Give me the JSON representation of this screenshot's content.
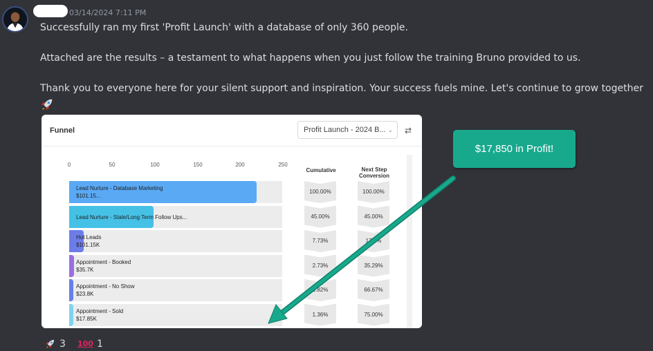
{
  "message": {
    "timestamp": "03/14/2024 7:11 PM",
    "line1": "Successfully ran my first 'Profit Launch' with a database of only 360 people.",
    "line2": "Attached are the results – a testament to what happens when you just follow the training Bruno provided to us.",
    "line3": "Thank you to everyone here for your silent support and inspiration. Your success fuels mine. Let's continue to grow together",
    "emoji": "rocket-icon"
  },
  "funnel_card": {
    "title": "Funnel",
    "dropdown_value": "Profit Launch - 2024 B...",
    "filter_icon": "swap-icon",
    "axis_ticks": [
      "0",
      "50",
      "100",
      "150",
      "200",
      "250"
    ],
    "cumulative_header": "Cumulative",
    "next_step_header_1": "Next Step",
    "next_step_header_2": "Conversion",
    "stages": [
      {
        "name": "Lead Nurture - Database Marketing",
        "value_label": "$101.15...",
        "bar_value": 220,
        "color": "#5aa9f5",
        "cumulative": "100.00%",
        "next_step": "100.00%"
      },
      {
        "name": "Lead Nurture - Stale/Long Term Follow Ups...",
        "value_label": "",
        "bar_value": 99,
        "color": "#45c1e6",
        "cumulative": "45.00%",
        "next_step": "45.00%"
      },
      {
        "name": "Hot Leads",
        "value_label": "$101.15K",
        "bar_value": 17,
        "color": "#6c7de8",
        "cumulative": "7.73%",
        "next_step": "17.7%"
      },
      {
        "name": "Appointment - Booked",
        "value_label": "$35.7K",
        "bar_value": 6,
        "color": "#9a6ee3",
        "cumulative": "2.73%",
        "next_step": "35.29%"
      },
      {
        "name": "Appointment - No Show",
        "value_label": "$23.8K",
        "bar_value": 4,
        "color": "#6a7ee8",
        "cumulative": "1.82%",
        "next_step": "66.67%"
      },
      {
        "name": "Appointment - Sold",
        "value_label": "$17.85K",
        "bar_value": 3,
        "color": "#7fd3ee",
        "cumulative": "1.36%",
        "next_step": "75.00%"
      }
    ]
  },
  "callout": {
    "text": "$17,850 in Profit!",
    "color": "#18a98d"
  },
  "reactions": [
    {
      "icon": "rocket-icon",
      "count": "3"
    },
    {
      "icon": "hundred-points-icon",
      "label": "100",
      "count": "1"
    }
  ]
}
